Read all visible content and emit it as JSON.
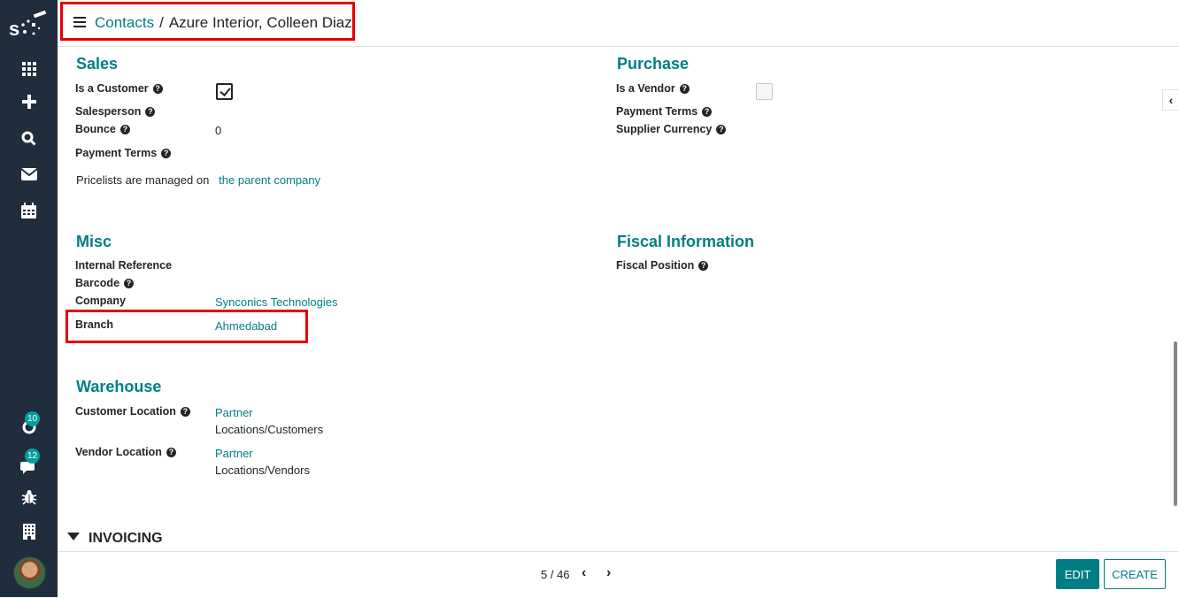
{
  "sidebar": {
    "logo_icon": "synconics-logo",
    "items": [
      {
        "icon": "apps-grid-icon"
      },
      {
        "icon": "plus-icon"
      },
      {
        "icon": "search-icon"
      },
      {
        "icon": "mail-icon"
      },
      {
        "icon": "calendar-icon"
      }
    ],
    "activity_badge": "10",
    "messages_badge": "12"
  },
  "header": {
    "breadcrumb_root": "Contacts",
    "breadcrumb_sep": "/",
    "breadcrumb_current": "Azure Interior, Colleen Diaz"
  },
  "sales": {
    "title": "Sales",
    "is_customer_label": "Is a Customer",
    "is_customer": true,
    "salesperson_label": "Salesperson",
    "bounce_label": "Bounce",
    "bounce_value": "0",
    "payment_terms_label": "Payment Terms",
    "pricelist_text": "Pricelists are managed on",
    "pricelist_link": "the parent company"
  },
  "purchase": {
    "title": "Purchase",
    "is_vendor_label": "Is a Vendor",
    "is_vendor": false,
    "payment_terms_label": "Payment Terms",
    "supplier_currency_label": "Supplier Currency"
  },
  "misc": {
    "title": "Misc",
    "internal_reference_label": "Internal Reference",
    "barcode_label": "Barcode",
    "company_label": "Company",
    "company_value": "Synconics Technologies",
    "branch_label": "Branch",
    "branch_value": "Ahmedabad"
  },
  "fiscal": {
    "title": "Fiscal Information",
    "fiscal_position_label": "Fiscal Position"
  },
  "warehouse": {
    "title": "Warehouse",
    "customer_location_label": "Customer Location",
    "customer_location_line1": "Partner",
    "customer_location_line2": "Locations/Customers",
    "vendor_location_label": "Vendor Location",
    "vendor_location_line1": "Partner",
    "vendor_location_line2": "Locations/Vendors"
  },
  "invoicing": {
    "title": "INVOICING"
  },
  "pager": {
    "value": "5 / 46"
  },
  "buttons": {
    "edit": "EDIT",
    "create": "CREATE"
  },
  "help_glyph": "?",
  "colors": {
    "accent": "#017e84",
    "sidebar": "#1f2d3d",
    "highlight": "#e60000"
  }
}
